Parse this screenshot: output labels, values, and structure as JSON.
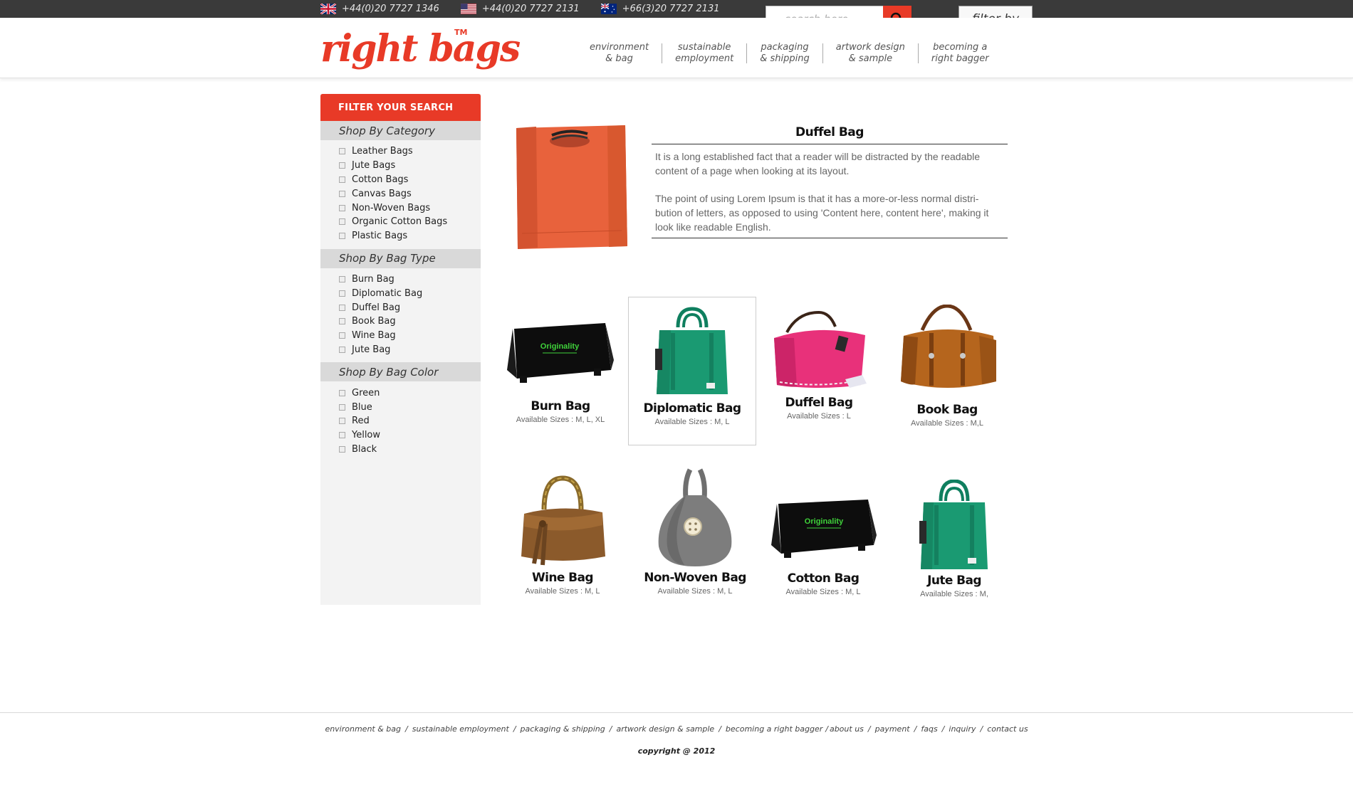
{
  "topbar": {
    "phones": [
      {
        "flag": "uk-flag-icon",
        "number": "+44(0)20 7727 1346"
      },
      {
        "flag": "us-flag-icon",
        "number": "+44(0)20 7727 2131"
      },
      {
        "flag": "au-flag-icon",
        "number": "+66(3)20 7727 2131"
      }
    ],
    "search_placeholder": "search here . . .",
    "filter_label": "filter by"
  },
  "header": {
    "logo_text": "right bags",
    "logo_tm": "TM",
    "nav": [
      {
        "line1": "environment",
        "line2": "& bag"
      },
      {
        "line1": "sustainable",
        "line2": "employment"
      },
      {
        "line1": "packaging",
        "line2": "& shipping"
      },
      {
        "line1": "artwork design",
        "line2": "& sample"
      },
      {
        "line1": "becoming a",
        "line2": "right bagger"
      }
    ]
  },
  "sidebar": {
    "title": "FILTER YOUR SEARCH",
    "sections": [
      {
        "title": "Shop By Category",
        "items": [
          "Leather Bags",
          "Jute Bags",
          "Cotton Bags",
          "Canvas Bags",
          "Non-Woven Bags",
          "Organic Cotton Bags",
          "Plastic Bags"
        ]
      },
      {
        "title": "Shop By Bag Type",
        "items": [
          "Burn Bag",
          "Diplomatic Bag",
          "Duffel Bag",
          "Book Bag",
          "Wine Bag",
          "Jute Bag"
        ]
      },
      {
        "title": "Shop By Bag Color",
        "items": [
          "Green",
          "Blue",
          "Red",
          "Yellow",
          "Black"
        ]
      }
    ]
  },
  "featured": {
    "title": "Duffel Bag",
    "para1": "It is a long established fact that a reader will be distracted by the readable content of a page when looking at its layout.",
    "para2": "The point of using Lorem Ipsum is that it has a more-or-less normal distri-bution of letters, as opposed to using 'Content here, content here', making it look like readable English."
  },
  "products": [
    {
      "name": "Burn Bag",
      "sizes": "Available Sizes : M, L, XL"
    },
    {
      "name": "Diplomatic Bag",
      "sizes": "Available Sizes : M, L"
    },
    {
      "name": "Duffel Bag",
      "sizes": "Available Sizes :  L"
    },
    {
      "name": "Book Bag",
      "sizes": "Available Sizes :  M,L"
    },
    {
      "name": "Wine Bag",
      "sizes": "Available Sizes : M, L"
    },
    {
      "name": "Non-Woven Bag",
      "sizes": "Available Sizes : M, L"
    },
    {
      "name": "Cotton Bag",
      "sizes": "Available Sizes : M, L"
    },
    {
      "name": "Jute Bag",
      "sizes": "Available Sizes : M,"
    }
  ],
  "print_text": "Originality",
  "footer": {
    "links": [
      "environment & bag",
      "sustainable employment",
      "packaging & shipping",
      "artwork design & sample",
      "becoming a right bagger",
      "about us",
      "payment",
      "faqs",
      "inquiry",
      "contact us"
    ],
    "copyright": "copyright @ 2012"
  },
  "colors": {
    "accent": "#e83a27",
    "topbar": "#3a3a3a",
    "sidebar_bg": "#f3f3f3",
    "section_head": "#d9d9d9"
  }
}
